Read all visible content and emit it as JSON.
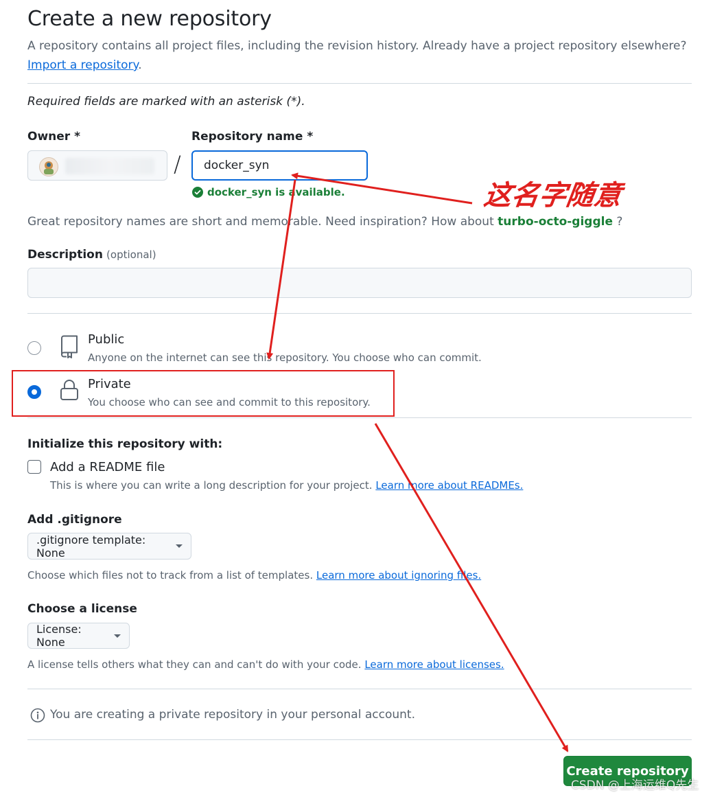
{
  "header": {
    "title": "Create a new repository",
    "subtitle": "A repository contains all project files, including the revision history. Already have a project repository elsewhere?",
    "import_link": "Import a repository",
    "import_suffix": "."
  },
  "required_note": "Required fields are marked with an asterisk (*).",
  "owner": {
    "label": "Owner *"
  },
  "slash": "/",
  "repo_name": {
    "label": "Repository name *",
    "value": "docker_syn",
    "status": "docker_syn is available."
  },
  "suggestion": {
    "prefix": "Great repository names are short and memorable. Need inspiration? How about",
    "name": "turbo-octo-giggle",
    "suffix": "?"
  },
  "description": {
    "label": "Description",
    "optional": "(optional)",
    "value": ""
  },
  "visibility": {
    "public": {
      "title": "Public",
      "desc": "Anyone on the internet can see this repository. You choose who can commit."
    },
    "private": {
      "title": "Private",
      "desc": "You choose who can see and commit to this repository."
    }
  },
  "init": {
    "heading": "Initialize this repository with:",
    "readme_label": "Add a README file",
    "readme_desc": "This is where you can write a long description for your project.",
    "readme_link": "Learn more about READMEs."
  },
  "gitignore": {
    "heading": "Add .gitignore",
    "button": ".gitignore template: None",
    "desc": "Choose which files not to track from a list of templates.",
    "link": "Learn more about ignoring files."
  },
  "license": {
    "heading": "Choose a license",
    "button": "License: None",
    "desc": "A license tells others what they can and can't do with your code.",
    "link": "Learn more about licenses."
  },
  "info": "You are creating a private repository in your personal account.",
  "create_button": "Create repository",
  "annotation": {
    "text": "这名字随意",
    "color": "#e0201e"
  },
  "watermark": "CSDN @上海运维Q先生",
  "colors": {
    "accent": "#0969da",
    "success": "#1a7f37",
    "primary": "#1f883d"
  }
}
